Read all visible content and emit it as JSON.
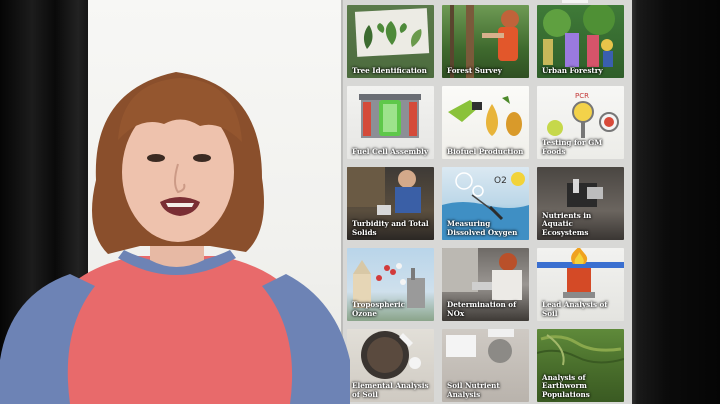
{
  "colors": {
    "panel_bg": "#d8d8d6",
    "shirt_pink": "#e86a6b",
    "shirt_sleeve": "#6d83b5",
    "hair": "#8a4f2c"
  },
  "lab_grid": {
    "tiles": [
      {
        "title": "Tree Identification",
        "icon": "leaf-icon"
      },
      {
        "title": "Forest Survey",
        "icon": "tree-icon"
      },
      {
        "title": "Urban Forestry",
        "icon": "city-tree-icon"
      },
      {
        "title": "Fuel Cell Assembly",
        "icon": "fuel-cell-icon"
      },
      {
        "title": "Biofuel Production",
        "icon": "fuel-pump-icon"
      },
      {
        "title": "Testing for GM Foods",
        "icon": "magnifier-icon",
        "badge": "PCR"
      },
      {
        "title": "Turbidity and Total Solids",
        "icon": "water-sample-icon"
      },
      {
        "title": "Measuring Dissolved Oxygen",
        "icon": "oxygen-icon",
        "badge": "O2"
      },
      {
        "title": "Nutrients in Aquatic Ecosystems",
        "icon": "cuvette-icon"
      },
      {
        "title": "Tropospheric Ozone",
        "icon": "factory-icon"
      },
      {
        "title": "Determination of NOx",
        "icon": "lab-worker-icon"
      },
      {
        "title": "Lead Analysis of Soil",
        "icon": "flame-icon"
      },
      {
        "title": "Elemental Analysis of Soil",
        "icon": "petri-dish-icon"
      },
      {
        "title": "Soil Nutrient Analysis",
        "icon": "balance-icon"
      },
      {
        "title": "Analysis of Earthworm Populations",
        "icon": "earthworm-icon"
      }
    ]
  }
}
